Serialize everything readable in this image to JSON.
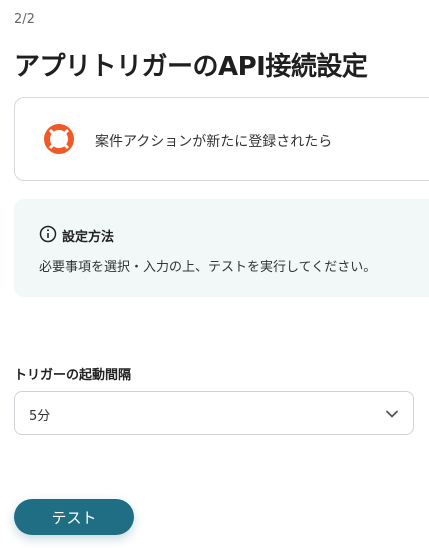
{
  "header": {
    "step": "2/2",
    "title": "アプリトリガーのAPI接続設定"
  },
  "trigger_card": {
    "icon": "lifebuoy-icon",
    "label": "案件アクションが新たに登録されたら"
  },
  "info_box": {
    "icon": "info-icon",
    "title": "設定方法",
    "text": "必要事項を選択・入力の上、テストを実行してください。"
  },
  "interval_field": {
    "label": "トリガーの起動間隔",
    "selected_value": "5分",
    "icon": "chevron-down-icon"
  },
  "actions": {
    "test_label": "テスト"
  },
  "colors": {
    "accent": "#1f6e84",
    "info_background": "#f1f8f7",
    "app_icon_orange": "#f05a28"
  }
}
